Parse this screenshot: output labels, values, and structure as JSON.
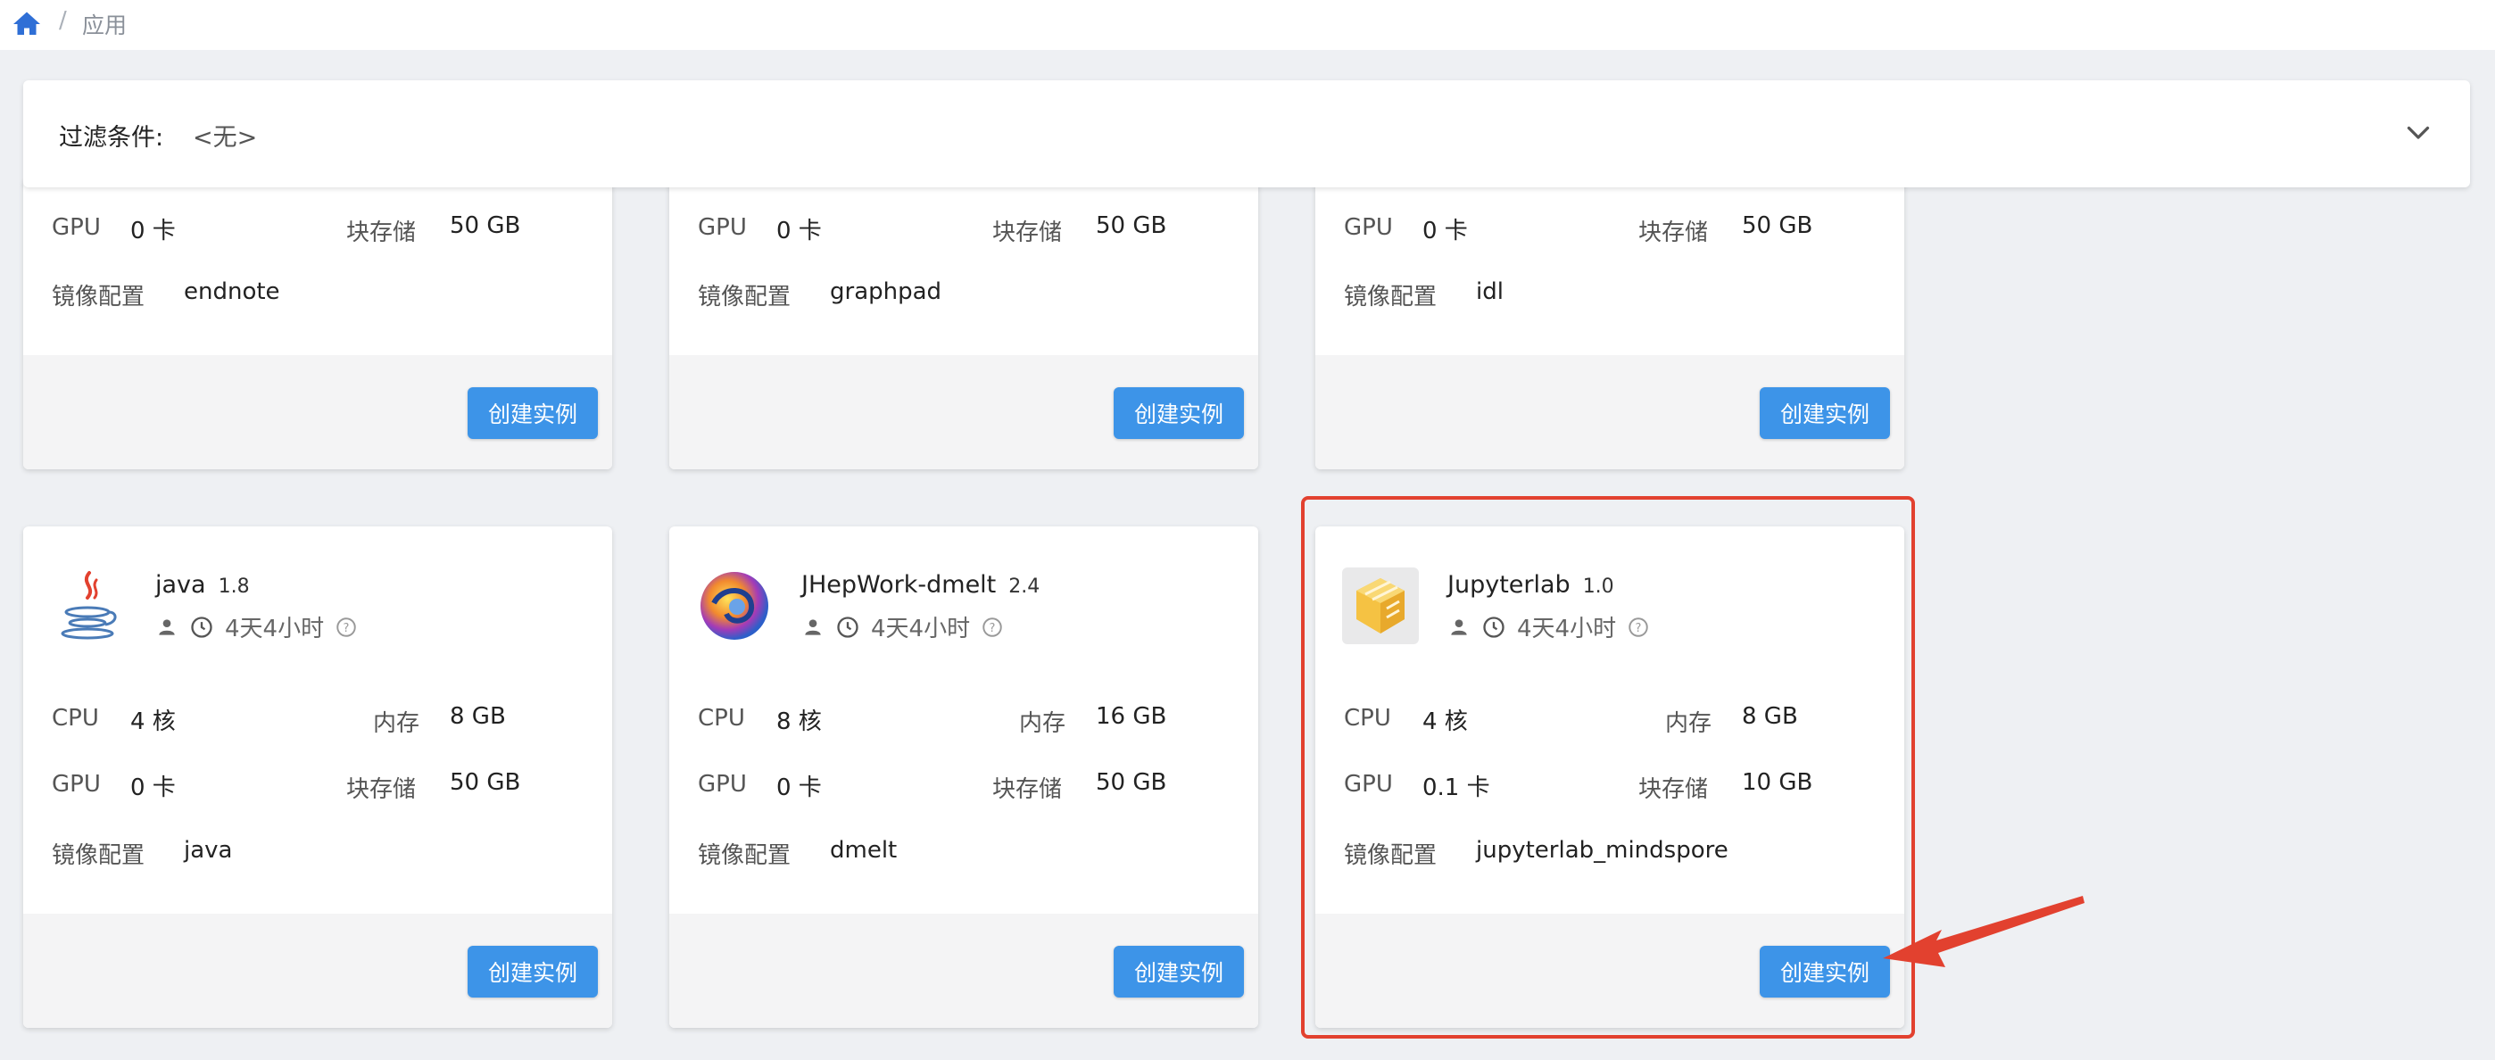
{
  "breadcrumb": {
    "separator": "/",
    "current": "应用"
  },
  "filter": {
    "label": "过滤条件:",
    "value": "<无>"
  },
  "labels": {
    "cpu": "CPU",
    "memory": "内存",
    "gpu": "GPU",
    "storage": "块存储",
    "image": "镜像配置",
    "create": "创建实例"
  },
  "top_cards": [
    {
      "gpu": "0 卡",
      "storage": "50 GB",
      "image": "endnote"
    },
    {
      "gpu": "0 卡",
      "storage": "50 GB",
      "image": "graphpad"
    },
    {
      "gpu": "0 卡",
      "storage": "50 GB",
      "image": "idl"
    }
  ],
  "cards": [
    {
      "name": "java",
      "version": "1.8",
      "time": "4天4小时",
      "cpu": "4 核",
      "memory": "8 GB",
      "gpu": "0 卡",
      "storage": "50 GB",
      "image": "java",
      "icon": "java-icon"
    },
    {
      "name": "JHepWork-dmelt",
      "version": "2.4",
      "time": "4天4小时",
      "cpu": "8 核",
      "memory": "16 GB",
      "gpu": "0 卡",
      "storage": "50 GB",
      "image": "dmelt",
      "icon": "jhepwork-icon"
    },
    {
      "name": "Jupyterlab",
      "version": "1.0",
      "time": "4天4小时",
      "cpu": "4 核",
      "memory": "8 GB",
      "gpu": "0.1 卡",
      "storage": "10 GB",
      "image": "jupyterlab_mindspore",
      "icon": "jupyterlab-icon"
    }
  ],
  "colors": {
    "accent": "#3d94e8",
    "highlight": "#e2412f",
    "background": "#eef0f3"
  }
}
